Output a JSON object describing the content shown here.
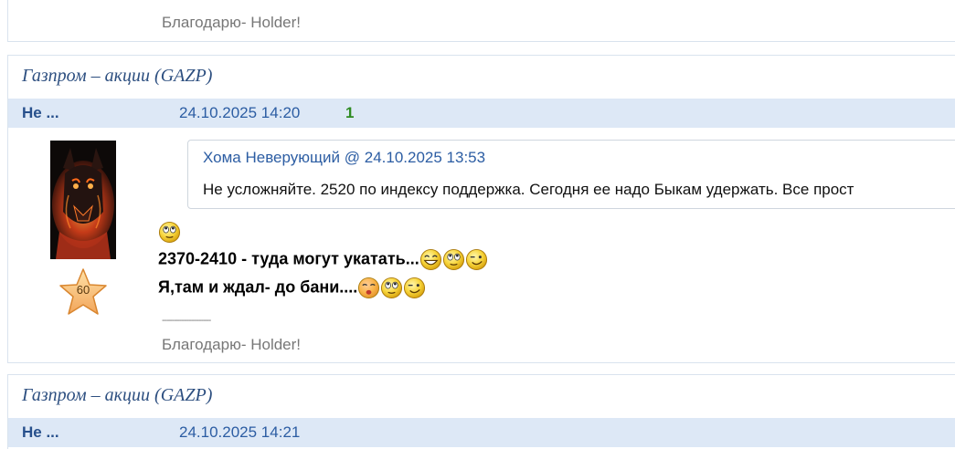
{
  "prev_post": {
    "sig_dashes": "--------------------",
    "signature": "Благодарю- Holder!"
  },
  "post": {
    "topic": "Газпром – акции (GAZP)",
    "author": "Не ...",
    "datetime": "24.10.2025 14:20",
    "score": "1",
    "rank": "60",
    "quote": {
      "author": "Хома Неверующий",
      "at": "@",
      "datetime": "24.10.2025 13:53",
      "text": "Не усложняйте. 2520 по индексу поддержка. Сегодня ее надо Быкам удержать. Все прост"
    },
    "lines": [
      "2370-2410 - туда могут укатать...",
      "Я,там и ждал- до бани...."
    ],
    "sig_dashes": "--------------------",
    "signature": "Благодарю- Holder!"
  },
  "next_post": {
    "topic": "Газпром – акции (GAZP)",
    "author": "Не ...",
    "datetime": "24.10.2025 14:21"
  },
  "icons": {
    "smiley_face": "smiley-icon",
    "rank": "star-icon",
    "avatar": "dog-avatar"
  },
  "colors": {
    "topic": "#2d4f80",
    "meta_bar": "#dde8f6",
    "author": "#27508c",
    "date": "#2c5da3",
    "score": "#2e8b22",
    "signature": "#777777"
  }
}
